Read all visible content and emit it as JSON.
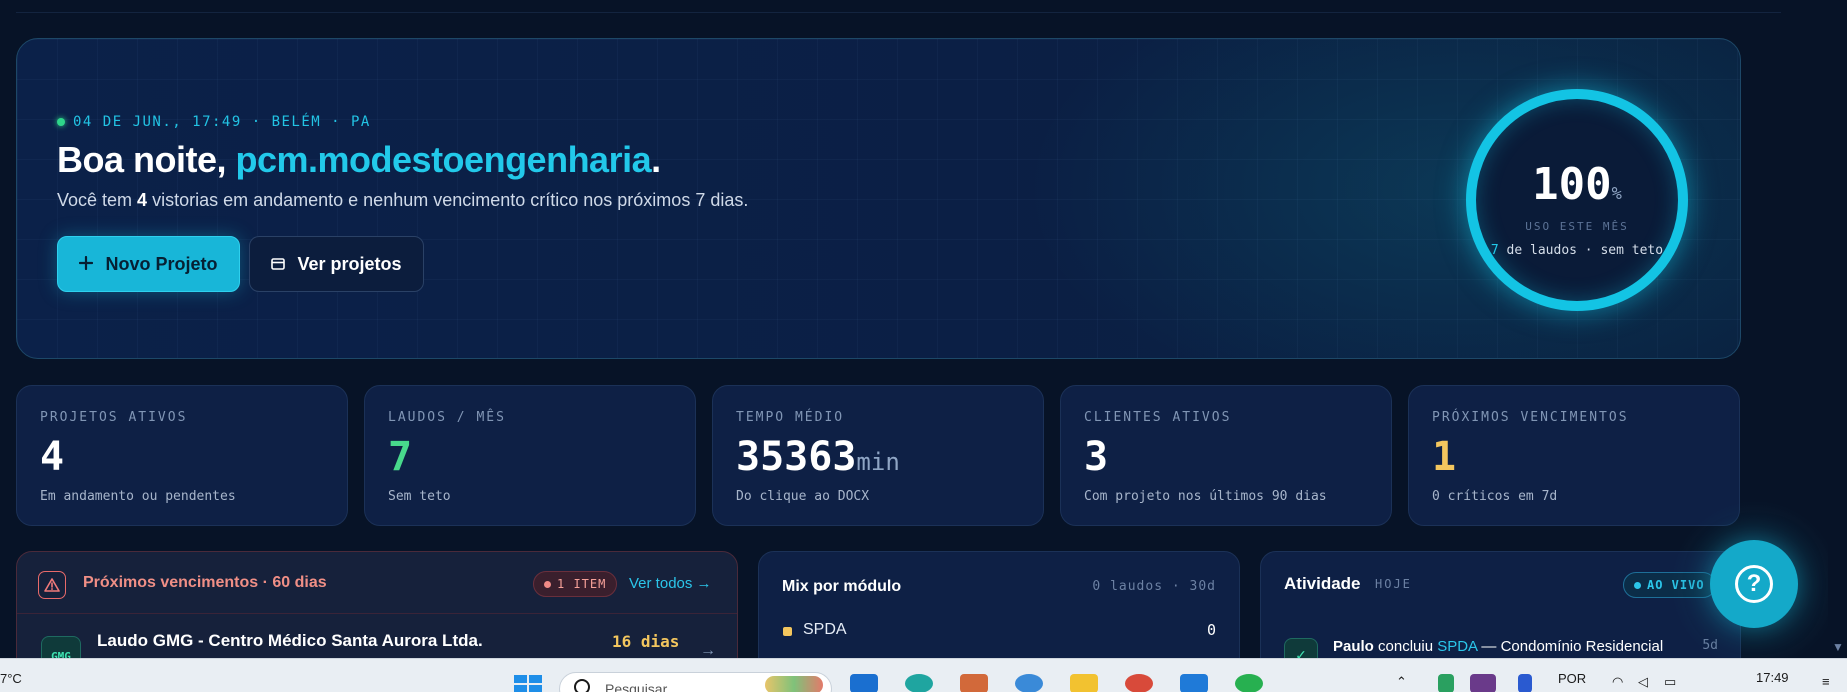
{
  "hero": {
    "meta": "04 DE JUN., 17:49 · BELÉM · PA",
    "greeting": "Boa noite, ",
    "username": "pcm.modestoengenharia",
    "period": ".",
    "sub_pre": "Você tem ",
    "sub_count": "4",
    "sub_post": " vistorias em andamento e nenhum vencimento crítico nos próximos 7 dias.",
    "btn_new": "Novo Projeto",
    "btn_view": "Ver projetos",
    "usage": {
      "value": "100",
      "unit": "%",
      "caption": "USO ESTE MÊS",
      "count": "7",
      "detail": " de laudos · sem teto"
    }
  },
  "stats": [
    {
      "label": "PROJETOS ATIVOS",
      "value": "4",
      "unit": "",
      "desc": "Em andamento ou pendentes",
      "color": "#ffffff"
    },
    {
      "label": "LAUDOS / MÊS",
      "value": "7",
      "unit": "",
      "desc": "Sem teto",
      "color": "#48d98c"
    },
    {
      "label": "TEMPO MÉDIO",
      "value": "35363",
      "unit": "min",
      "desc": "Do clique ao DOCX",
      "color": "#ffffff"
    },
    {
      "label": "CLIENTES ATIVOS",
      "value": "3",
      "unit": "",
      "desc": "Com projeto nos últimos 90 dias",
      "color": "#ffffff"
    },
    {
      "label": "PRÓXIMOS VENCIMENTOS",
      "value": "1",
      "unit": "",
      "desc": "0 críticos em 7d",
      "color": "#f3c65e"
    }
  ],
  "alerts": {
    "title": "Próximos vencimentos · 60 dias",
    "badge": "1 ITEM",
    "see_all": "Ver todos →",
    "item": {
      "tag": "GMG",
      "title": "Laudo GMG - Centro Médico Santa Aurora Ltda.",
      "days": "16 dias"
    }
  },
  "mix": {
    "title": "Mix por módulo",
    "meta": "0 laudos · 30d",
    "item": "SPDA",
    "count": "0"
  },
  "activity": {
    "title": "Atividade",
    "period": "HOJE",
    "live": "AO VIVO",
    "entry": {
      "actor": "Paulo",
      "verb": " concluiu ",
      "module": "SPDA",
      "target": " — Condomínio Residencial",
      "time": "5d"
    }
  },
  "taskbar": {
    "temp": "7°C",
    "search_placeholder": "Pesquisar",
    "lang": "POR",
    "time": "17:49"
  },
  "colors": {
    "accent": "#22c9ea",
    "success": "#48d98c",
    "warning": "#f3c65e",
    "danger": "#f08f86"
  }
}
